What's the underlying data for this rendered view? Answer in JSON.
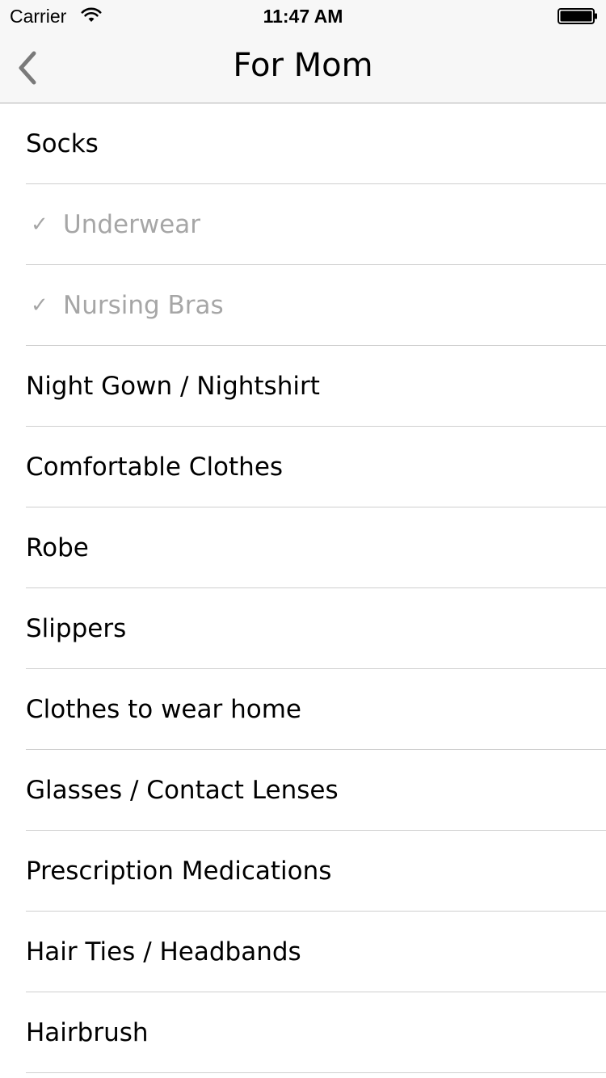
{
  "status_bar": {
    "carrier": "Carrier",
    "time": "11:47 AM"
  },
  "nav": {
    "title": "For Mom",
    "back_icon": "chevron-left-icon"
  },
  "colors": {
    "checked_text": "#a6a6a6",
    "separator": "#cfcfcf",
    "bar_background": "#f7f7f7"
  },
  "items": [
    {
      "label": "Socks",
      "checked": false
    },
    {
      "label": "Underwear",
      "checked": true
    },
    {
      "label": "Nursing Bras",
      "checked": true
    },
    {
      "label": "Night Gown / Nightshirt",
      "checked": false
    },
    {
      "label": "Comfortable Clothes",
      "checked": false
    },
    {
      "label": "Robe",
      "checked": false
    },
    {
      "label": "Slippers",
      "checked": false
    },
    {
      "label": "Clothes to wear home",
      "checked": false
    },
    {
      "label": "Glasses / Contact Lenses",
      "checked": false
    },
    {
      "label": "Prescription Medications",
      "checked": false
    },
    {
      "label": "Hair Ties / Headbands",
      "checked": false
    },
    {
      "label": "Hairbrush",
      "checked": false
    }
  ],
  "check_glyph": "✓"
}
